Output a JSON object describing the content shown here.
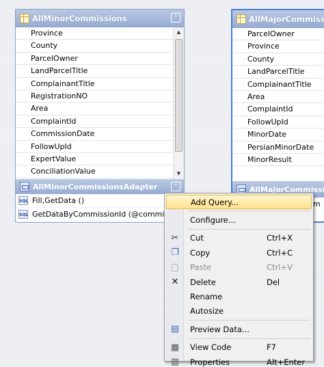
{
  "left_table": {
    "title": "AllMinorCommissions",
    "columns": [
      "Province",
      "County",
      "ParcelOwner",
      "LandParcelTitle",
      "ComplainantTitle",
      "RegistrationNO",
      "Area",
      "ComplaintId",
      "CommissionDate",
      "FollowUpId",
      "ExpertValue",
      "ConciliationValue"
    ]
  },
  "left_adapter": {
    "title": "AllMinorCommissionsAdapter",
    "queries": [
      "Fill,GetData ()",
      "GetDataByCommissionId (@commissi"
    ]
  },
  "right_table": {
    "title": "AllMajorCommissio",
    "columns": [
      "ParcelOwner",
      "Province",
      "County",
      "LandParcelTitle",
      "ComplainantTitle",
      "Area",
      "ComplaintId",
      "FollowUpId",
      "MinorDate",
      "PersianMinorDate",
      "MinorResult"
    ]
  },
  "right_adapter": {
    "title": "AllMajorCommissi",
    "query_fragment": "m"
  },
  "icons": {
    "sql": "SQL",
    "collapse": "⌃",
    "scroll_up": "▲",
    "scroll_down": "▼"
  },
  "context_menu": {
    "items": [
      {
        "label": "Add Query...",
        "shortcut": "",
        "icon": "",
        "highlighted": true
      },
      {
        "label": "Configure...",
        "shortcut": "",
        "icon": ""
      },
      {
        "label": "Cut",
        "shortcut": "Ctrl+X",
        "icon": "✂"
      },
      {
        "label": "Copy",
        "shortcut": "Ctrl+C",
        "icon": "❐"
      },
      {
        "label": "Paste",
        "shortcut": "Ctrl+V",
        "icon": "📋",
        "disabled": true
      },
      {
        "label": "Delete",
        "shortcut": "Del",
        "icon": "✕"
      },
      {
        "label": "Rename",
        "shortcut": "",
        "icon": ""
      },
      {
        "label": "Autosize",
        "shortcut": "",
        "icon": ""
      },
      {
        "label": "Preview Data...",
        "shortcut": "",
        "icon": "▤"
      },
      {
        "label": "View Code",
        "shortcut": "F7",
        "icon": "▦"
      },
      {
        "label": "Properties",
        "shortcut": "Alt+Enter",
        "icon": "▥"
      }
    ]
  }
}
